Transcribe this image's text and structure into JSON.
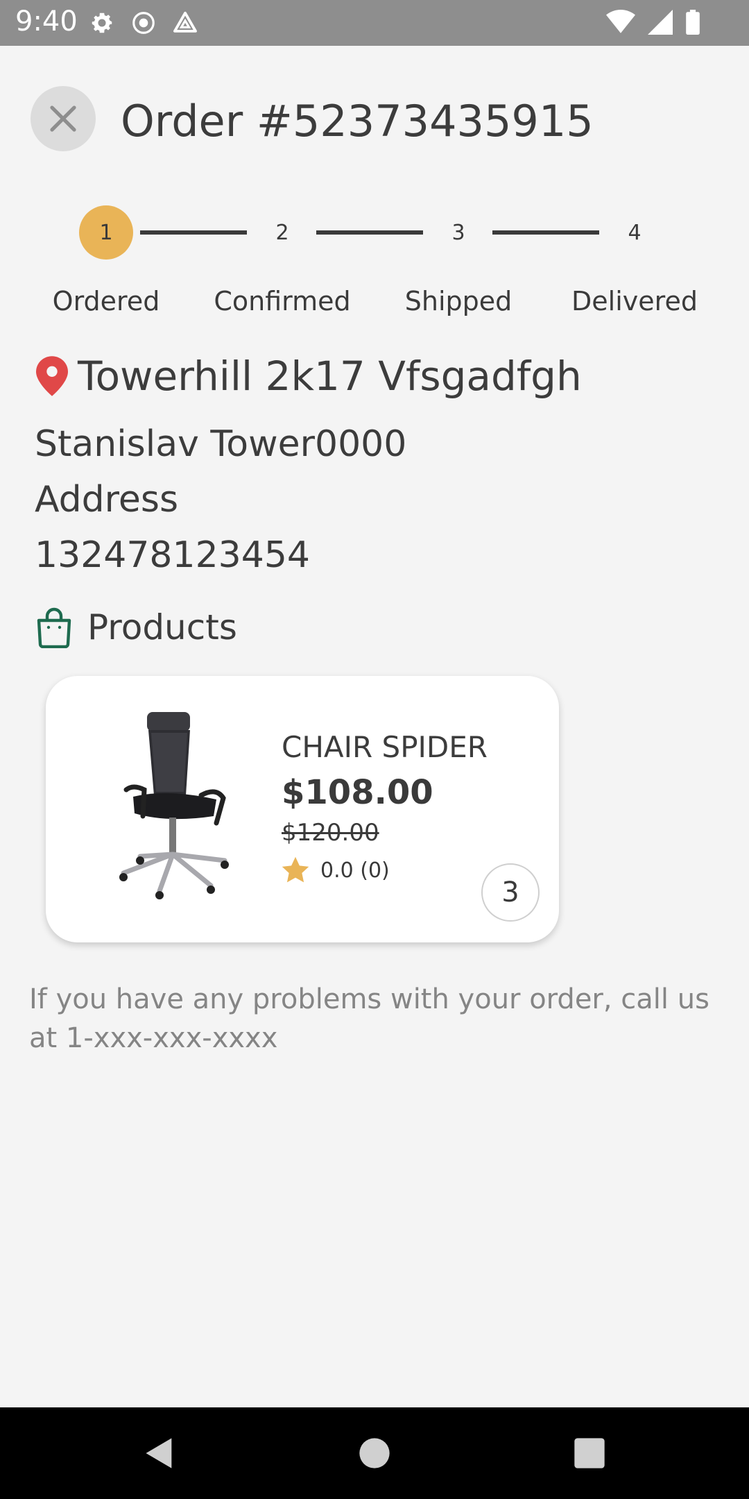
{
  "status_bar": {
    "time": "9:40"
  },
  "header": {
    "title": "Order #52373435915"
  },
  "stepper": {
    "steps": [
      {
        "number": "1",
        "label": "Ordered"
      },
      {
        "number": "2",
        "label": "Confirmed"
      },
      {
        "number": "3",
        "label": "Shipped"
      },
      {
        "number": "4",
        "label": "Delivered"
      }
    ],
    "active_step": 1
  },
  "address": {
    "title": "Towerhill 2k17 Vfsgadfgh",
    "name": "Stanislav Tower0000",
    "line": "Address",
    "phone": "132478123454"
  },
  "products": {
    "title": "Products",
    "items": [
      {
        "name": "CHAIR SPIDER",
        "price": "$108.00",
        "old_price": "$120.00",
        "rating": "0.0 (0)",
        "quantity": "3"
      }
    ]
  },
  "help": {
    "text": "If you have any problems with your order, call us at 1-xxx-xxx-xxxx"
  },
  "colors": {
    "accent": "#e9b457",
    "pin": "#e04848",
    "bag": "#1e6b4f",
    "star": "#e9b457"
  },
  "icons": {
    "close": "close-icon",
    "pin": "location-pin-icon",
    "bag": "shopping-bag-icon",
    "star": "star-icon"
  }
}
